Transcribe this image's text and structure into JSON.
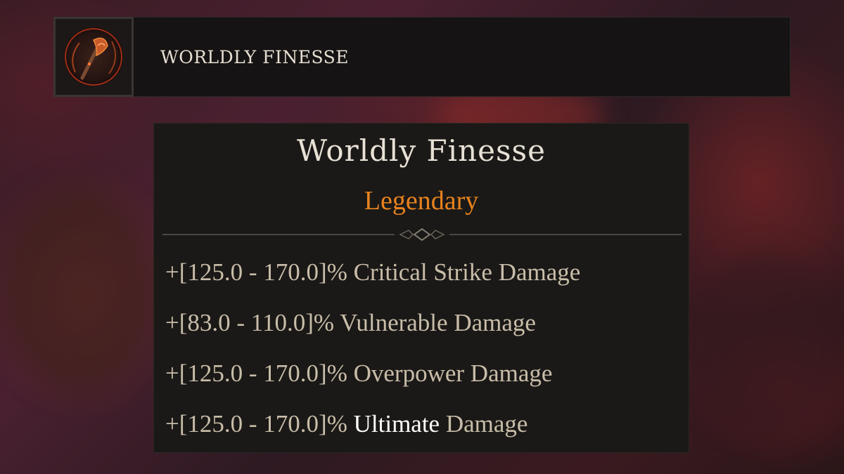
{
  "item_header": {
    "name": "WORLDLY FINESSE",
    "icon": "axe-icon"
  },
  "tooltip": {
    "title": "Worldly Finesse",
    "rarity": "Legendary",
    "rarity_color": "#e8821e",
    "affixes": [
      {
        "range": "+[125.0 - 170.0]%",
        "label": "Critical Strike Damage",
        "highlight": ""
      },
      {
        "range": "+[83.0 - 110.0]%",
        "label": "Vulnerable Damage",
        "highlight": ""
      },
      {
        "range": "+[125.0 - 170.0]%",
        "label": "Overpower Damage",
        "highlight": ""
      },
      {
        "range": "+[125.0 - 170.0]%",
        "label": "Damage",
        "highlight": "Ultimate"
      }
    ]
  }
}
